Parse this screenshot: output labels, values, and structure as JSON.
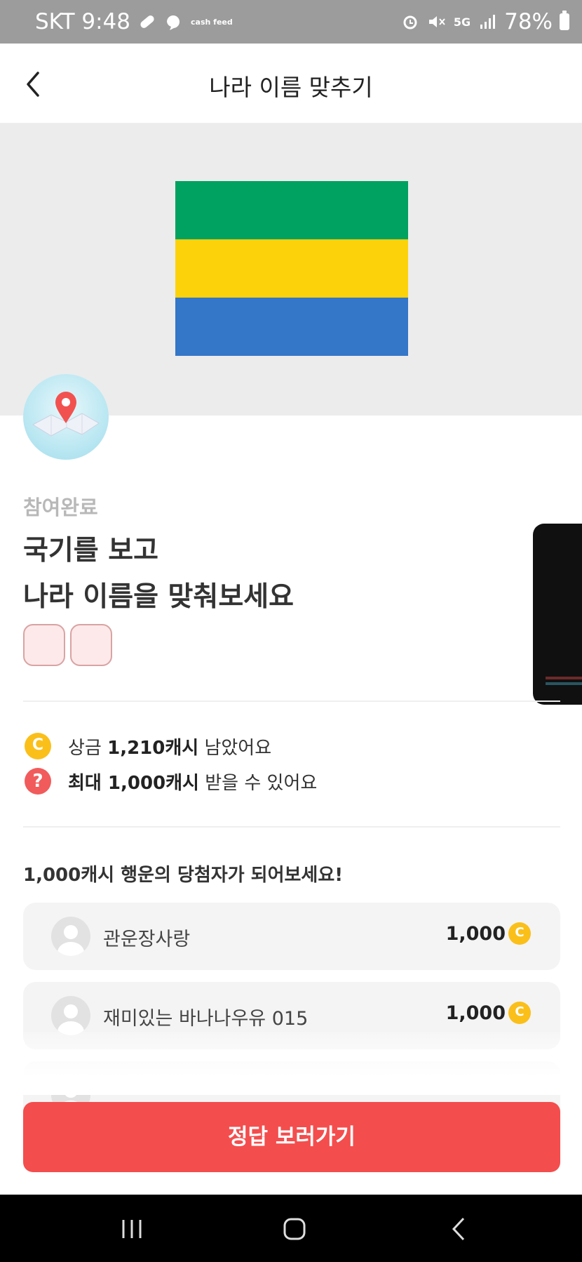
{
  "status_bar": {
    "carrier_time": "SKT 9:48",
    "cashfeed_logo": "cash feed",
    "network": "5G",
    "battery": "78%",
    "icons": [
      "pill-icon",
      "cashfeed-icon",
      "alarm-icon",
      "mute-icon",
      "5g-icon",
      "signal-icon",
      "battery-icon"
    ]
  },
  "header": {
    "title": "나라 이름 맞추기",
    "back_icon": "chevron-left-icon"
  },
  "flag": {
    "colors": [
      "#00a261",
      "#fcd20b",
      "#3476c8"
    ]
  },
  "quiz": {
    "icon": "map-pin-icon",
    "status": "참여완료",
    "question_line1": "국기를 보고",
    "question_line2": "나라 이름을 맞춰보세요",
    "answer_slots": 2
  },
  "info": {
    "prize_prefix": "상금 ",
    "prize_value": "1,210캐시",
    "prize_suffix": " 남았어요",
    "max_prefix": "최대 1,000캐시",
    "max_suffix": " 받을 수 있어요",
    "question_mark": "?"
  },
  "winners": {
    "title": "1,000캐시 행운의 당첨자가 되어보세요!",
    "items": [
      {
        "name": "관운장사랑",
        "amount": "1,000"
      },
      {
        "name": "재미있는 바나나우유 015",
        "amount": "1,000"
      }
    ]
  },
  "cta": {
    "label": "정답 보러가기"
  },
  "nav_bar": {
    "icons": [
      "recent-apps-icon",
      "home-icon",
      "back-icon"
    ]
  },
  "colors": {
    "accent": "#f44d4d",
    "coin": "#fbbf1a",
    "status_gray": "#b8b8b8"
  }
}
